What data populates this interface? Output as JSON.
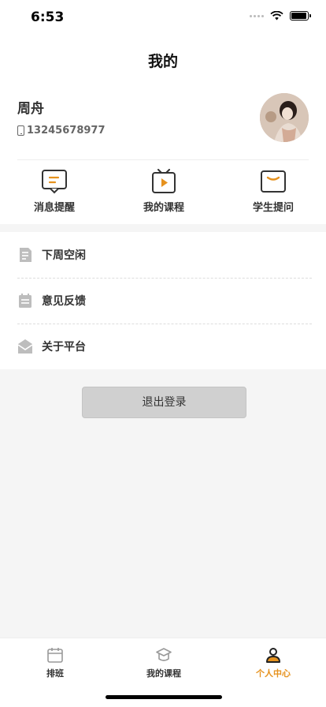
{
  "status_bar": {
    "time": "6:53"
  },
  "nav": {
    "title": "我的"
  },
  "profile": {
    "name": "周舟",
    "phone": "13245678977"
  },
  "quick_actions": [
    {
      "label": "消息提醒",
      "icon": "message-icon"
    },
    {
      "label": "我的课程",
      "icon": "tv-play-icon"
    },
    {
      "label": "学生提问",
      "icon": "question-box-icon"
    }
  ],
  "menu": [
    {
      "label": "下周空闲",
      "icon": "document-icon"
    },
    {
      "label": "意见反馈",
      "icon": "calendar-icon"
    },
    {
      "label": "关于平台",
      "icon": "mail-icon"
    }
  ],
  "logout_label": "退出登录",
  "tabbar": {
    "tabs": [
      {
        "label": "排班",
        "icon": "calendar-icon"
      },
      {
        "label": "我的课程",
        "icon": "graduation-cap-icon"
      },
      {
        "label": "个人中心",
        "icon": "person-icon"
      }
    ],
    "active_index": 2
  },
  "colors": {
    "accent": "#e6921e",
    "icon_gray": "#333333"
  }
}
